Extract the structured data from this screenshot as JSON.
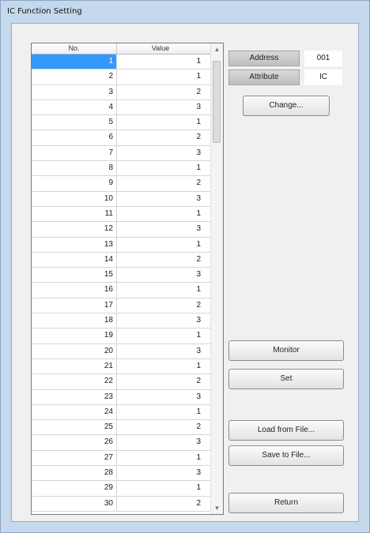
{
  "window": {
    "title": "IC Function Setting"
  },
  "grid": {
    "columns": {
      "no": "No.",
      "value": "Value"
    },
    "rows": [
      {
        "no": "1",
        "value": "1"
      },
      {
        "no": "2",
        "value": "1"
      },
      {
        "no": "3",
        "value": "2"
      },
      {
        "no": "4",
        "value": "3"
      },
      {
        "no": "5",
        "value": "1"
      },
      {
        "no": "6",
        "value": "2"
      },
      {
        "no": "7",
        "value": "3"
      },
      {
        "no": "8",
        "value": "1"
      },
      {
        "no": "9",
        "value": "2"
      },
      {
        "no": "10",
        "value": "3"
      },
      {
        "no": "11",
        "value": "1"
      },
      {
        "no": "12",
        "value": "3"
      },
      {
        "no": "13",
        "value": "1"
      },
      {
        "no": "14",
        "value": "2"
      },
      {
        "no": "15",
        "value": "3"
      },
      {
        "no": "16",
        "value": "1"
      },
      {
        "no": "17",
        "value": "2"
      },
      {
        "no": "18",
        "value": "3"
      },
      {
        "no": "19",
        "value": "1"
      },
      {
        "no": "20",
        "value": "3"
      },
      {
        "no": "21",
        "value": "1"
      },
      {
        "no": "22",
        "value": "2"
      },
      {
        "no": "23",
        "value": "3"
      },
      {
        "no": "24",
        "value": "1"
      },
      {
        "no": "25",
        "value": "2"
      },
      {
        "no": "26",
        "value": "3"
      },
      {
        "no": "27",
        "value": "1"
      },
      {
        "no": "28",
        "value": "3"
      },
      {
        "no": "29",
        "value": "1"
      },
      {
        "no": "30",
        "value": "2"
      }
    ],
    "selected_row": 0
  },
  "address": {
    "label": "Address",
    "value": "001"
  },
  "attribute": {
    "label": "Attribute",
    "value": "IC"
  },
  "buttons": {
    "change": "Change...",
    "monitor": "Monitor",
    "set": "Set",
    "load": "Load from File...",
    "save": "Save to File...",
    "return": "Return"
  },
  "colors": {
    "selection": "#3399ff",
    "window_frame": "#c5d8ec",
    "client_bg": "#f0f0f0"
  }
}
